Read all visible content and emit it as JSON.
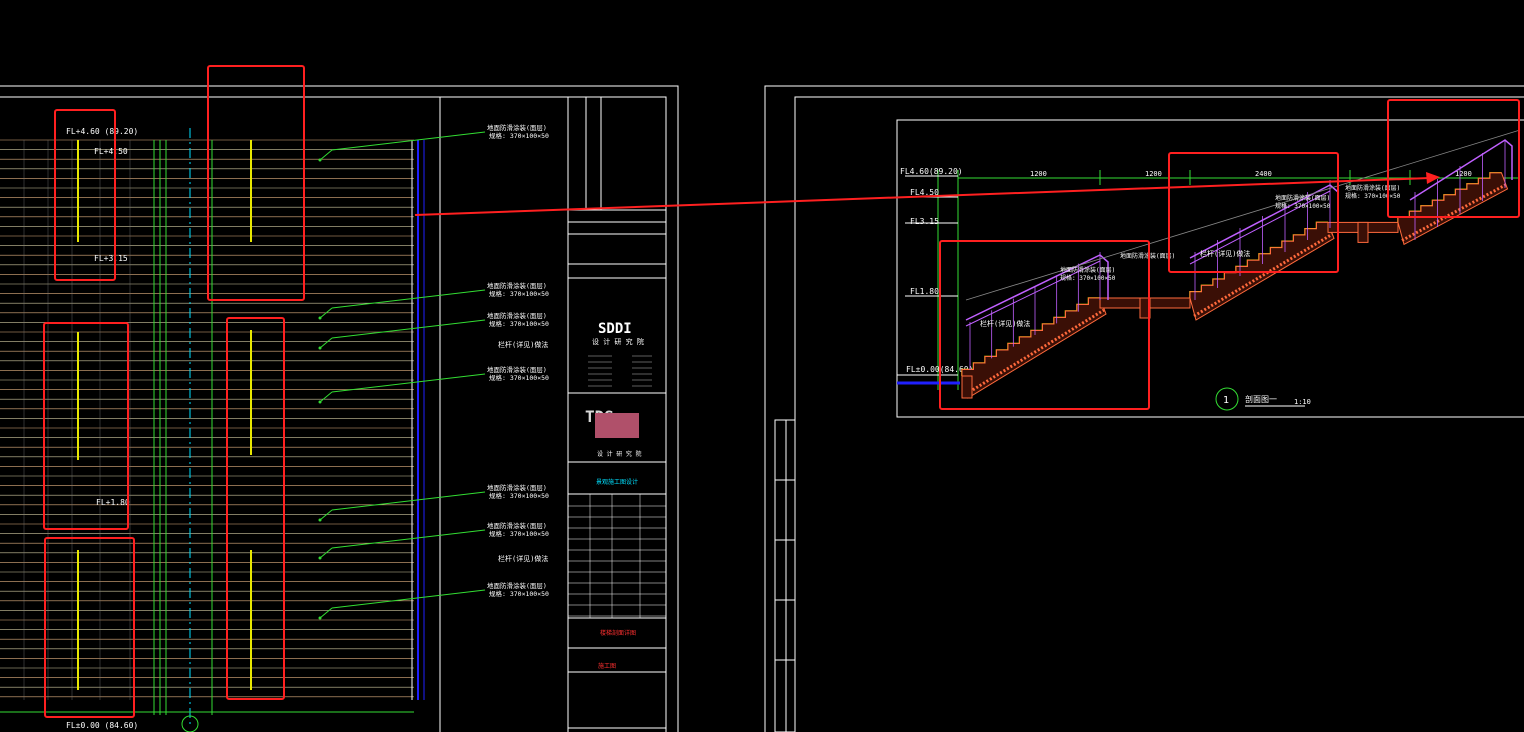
{
  "left_sheet": {
    "levels": {
      "top": "FL+4.60 (89.20)",
      "top2": "FL+4.50",
      "mid": "FL+3.15",
      "low": "FL+1.80",
      "base": "FL±0.00 (84.60)"
    },
    "callouts": [
      "地面防滑涂装(面层)",
      "地面防滑涂装(面层)",
      "地面防滑涂装(面层)",
      "地面防滑涂装(面层)",
      "地面防滑涂装(面层)",
      "地面防滑涂装(面层)",
      "地面防滑涂装(面层)"
    ],
    "callouts_sub": [
      "规格: 370×100×50",
      "规格: 370×100×50",
      "规格: 370×100×50",
      "规格: 370×100×50",
      "规格: 370×100×50",
      "规格: 370×100×50",
      "规格: 370×100×50"
    ],
    "label_note_1": "栏杆(详见)做法",
    "label_note_2": "栏杆(详见)做法"
  },
  "title_block": {
    "logo_text": "SDDI",
    "company": "设 计 研 究 院",
    "tds": "TDS",
    "project_line": "景观施工图设计",
    "drawing_name": "楼梯剖面详图",
    "red_note": "施工图"
  },
  "right_sheet": {
    "levels": {
      "top": "FL4.60(89.20)",
      "a": "FL4.50",
      "b": "FL3.15",
      "c": "FL1.80",
      "base": "FL±0.00(84.60)"
    },
    "dims": [
      "1200",
      "1200",
      "2400",
      "1200"
    ],
    "railing_label": "栏杆(详见)做法",
    "section_number": "1",
    "section_title": "剖面图一",
    "section_scale": "1:10"
  },
  "colors": {
    "background": "#000000",
    "highlight": "#ff2020",
    "white_line": "#ffffff",
    "green_line": "#33dd33",
    "yellow_line": "#e8e800",
    "orange_hatch": "#ff6a3c",
    "blue_line": "#2020ff",
    "cyan_line": "#00e0ff",
    "tan_line": "#e0b080"
  }
}
